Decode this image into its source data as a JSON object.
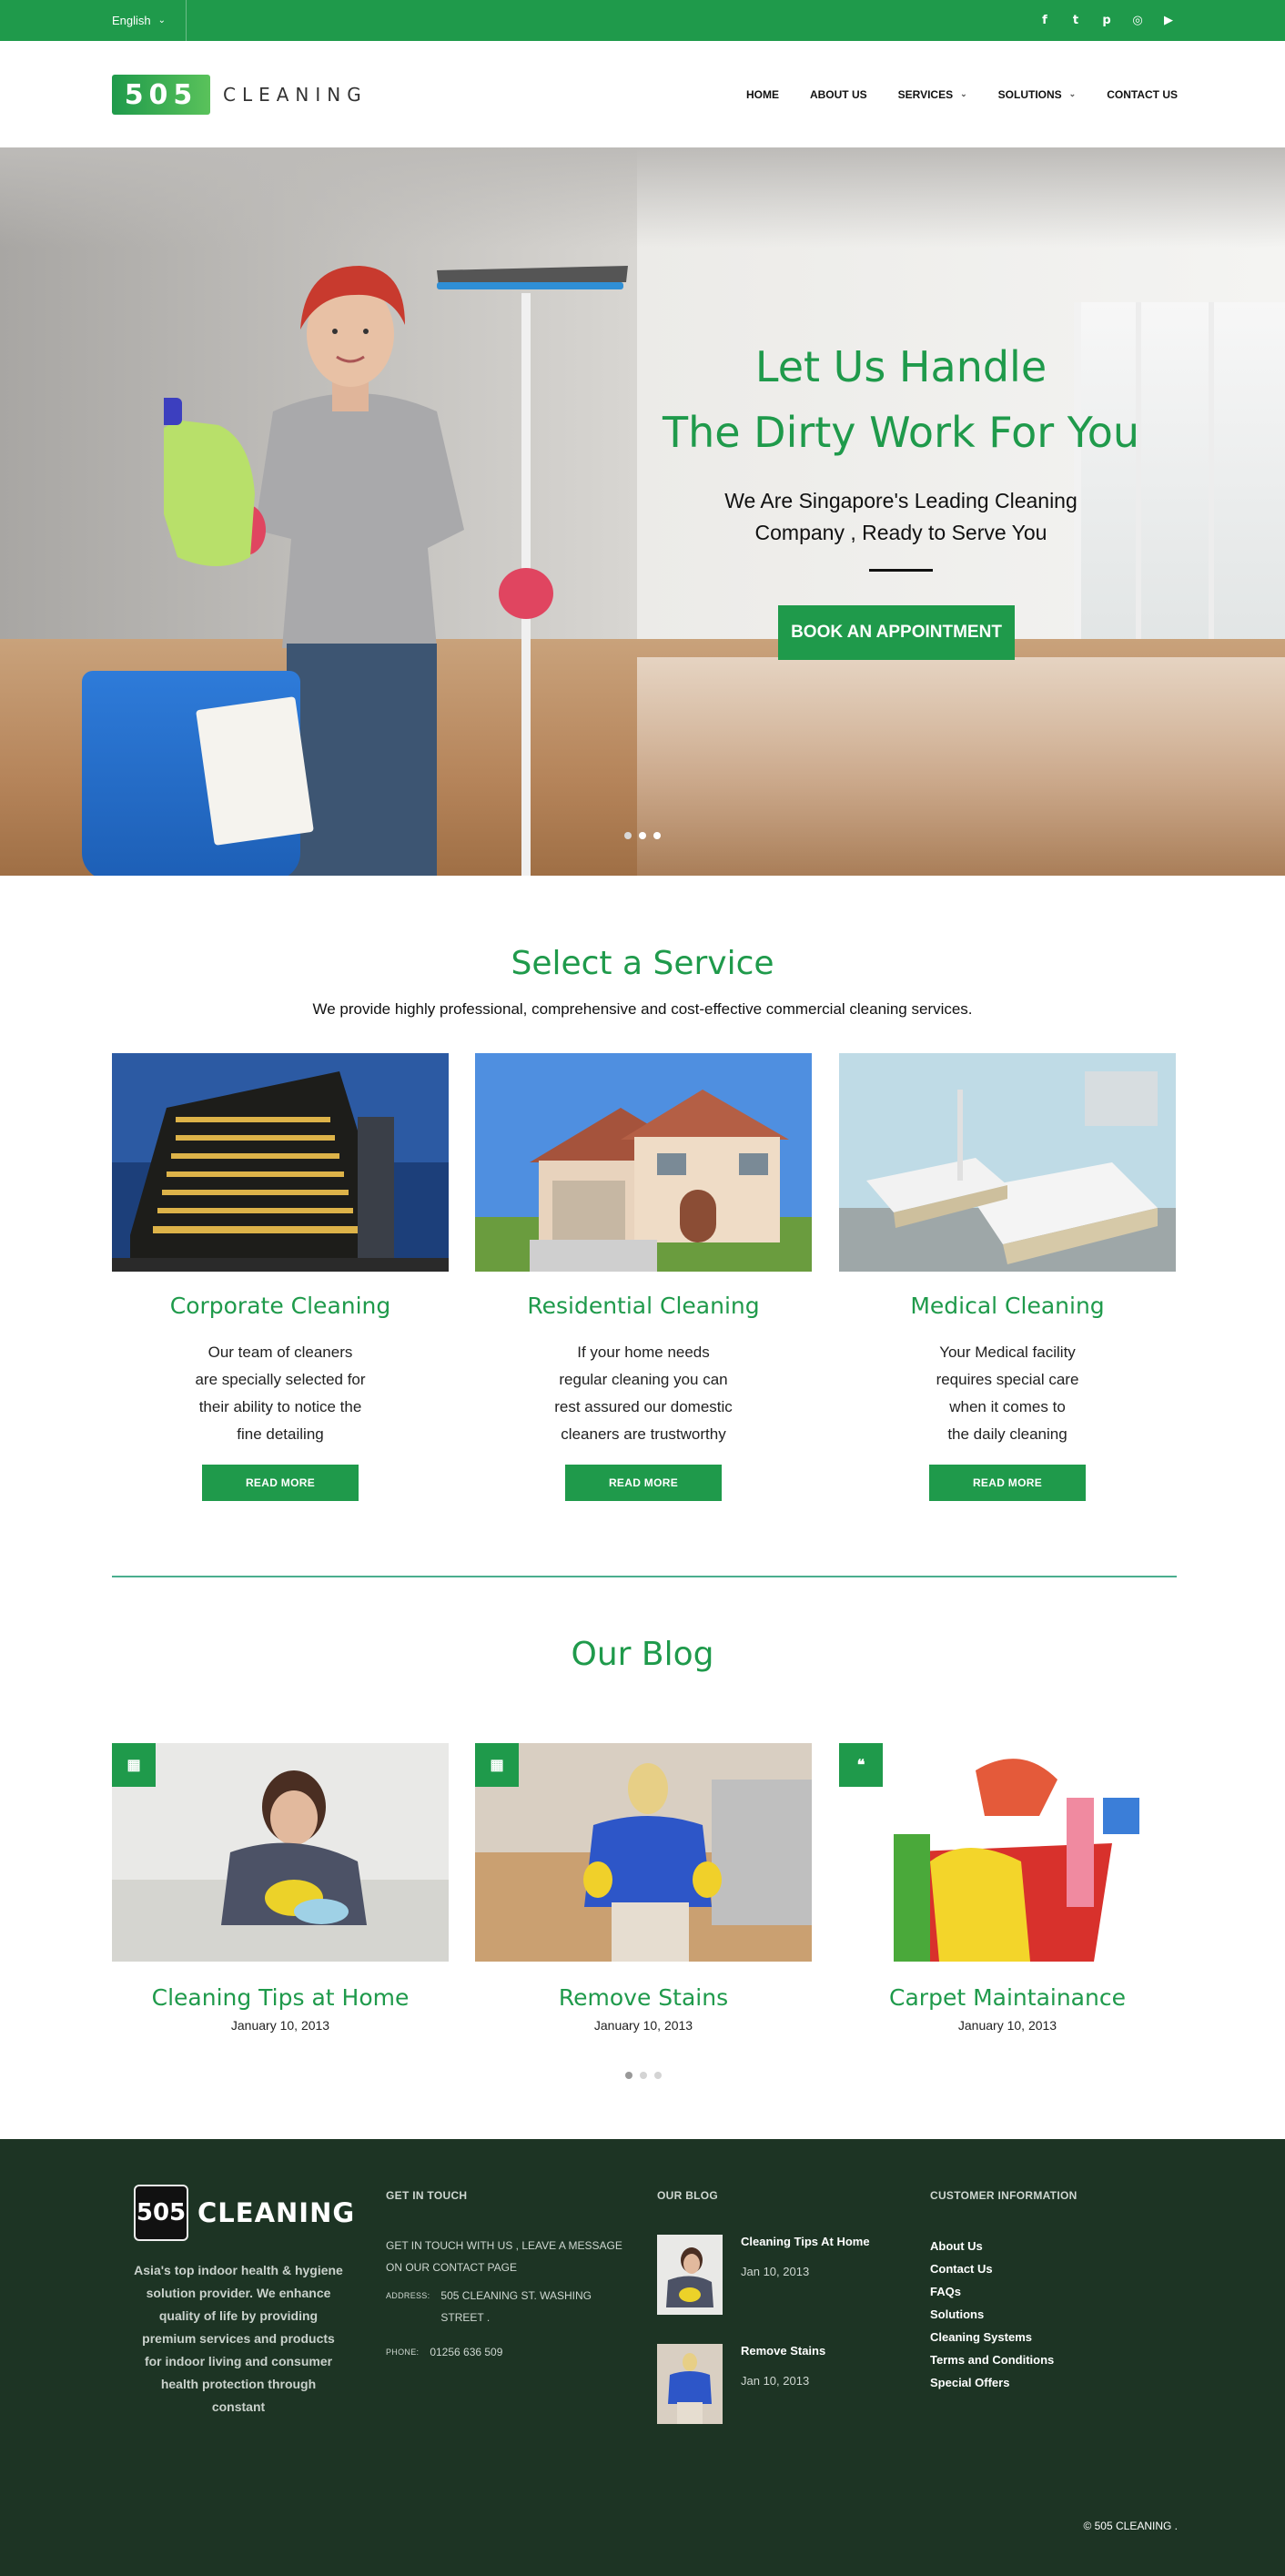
{
  "topbar": {
    "language": "English",
    "social": [
      "facebook-icon",
      "twitter-icon",
      "pinterest-icon",
      "instagram-icon",
      "youtube-icon"
    ],
    "social_glyphs": [
      "f",
      "t",
      "p",
      "◎",
      "▶"
    ]
  },
  "header": {
    "logo_mark": "505",
    "logo_text": "CLEANING",
    "nav": [
      "HOME",
      "ABOUT US",
      "SERVICES",
      "SOLUTIONS",
      "CONTACT US"
    ]
  },
  "hero": {
    "title_line1": "Let Us Handle",
    "title_line2": "The Dirty Work For You",
    "subtitle_line1": "We Are Singapore's Leading Cleaning",
    "subtitle_line2": "Company , Ready to Serve You",
    "button": "BOOK AN APPOINTMENT",
    "slide_count": 3,
    "active_slide": 2
  },
  "services": {
    "title": "Select a Service",
    "subtitle": "We provide highly professional, comprehensive and cost-effective commercial cleaning services.",
    "items": [
      {
        "title": "Corporate Cleaning",
        "lines": [
          "Our team of cleaners",
          "are specially selected for",
          "their ability to notice the",
          "fine detailing"
        ],
        "button": "READ MORE"
      },
      {
        "title": "Residential Cleaning",
        "lines": [
          "If your home needs",
          "regular cleaning you can",
          "rest assured our domestic",
          "cleaners are trustworthy"
        ],
        "button": "READ MORE"
      },
      {
        "title": "Medical Cleaning",
        "lines": [
          "Your Medical facility",
          "requires special care",
          "when it comes to",
          "the daily cleaning"
        ],
        "button": "READ MORE"
      }
    ]
  },
  "blog": {
    "title": "Our Blog",
    "posts": [
      {
        "title": "Cleaning Tips at Home",
        "date": "January 10, 2013",
        "badge": "▦"
      },
      {
        "title": "Remove Stains",
        "date": "January 10, 2013",
        "badge": "▦"
      },
      {
        "title": "Carpet Maintainance",
        "date": "January 10, 2013",
        "badge": "❝"
      }
    ]
  },
  "footer": {
    "logo_mark": "505",
    "logo_text": "CLEANING",
    "about": "Asia's top indoor health & hygiene solution provider. We enhance quality of life by providing premium services and products for indoor living and consumer health protection through constant",
    "get_in_touch": {
      "heading": "GET IN TOUCH",
      "text": "GET IN TOUCH WITH US , LEAVE A MESSAGE ON OUR CONTACT PAGE",
      "address_label": "ADDRESS:",
      "address_line1": "505 CLEANING ST. WASHING",
      "address_line2": "STREET .",
      "phone_label": "PHONE:",
      "phone": "01256 636 509"
    },
    "our_blog": {
      "heading": "OUR BLOG",
      "posts": [
        {
          "title": "Cleaning Tips At Home",
          "date": "Jan 10, 2013"
        },
        {
          "title": "Remove Stains",
          "date": "Jan 10, 2013"
        }
      ]
    },
    "customer_info": {
      "heading": "CUSTOMER INFORMATION",
      "links": [
        "About Us",
        "Contact Us",
        "FAQs",
        "Solutions",
        "Cleaning Systems",
        "Terms and Conditions",
        "Special Offers"
      ]
    },
    "copyright": "© 505 CLEANING ."
  },
  "colors": {
    "brand_green": "#1f9a4b",
    "footer_bg": "#1d3424",
    "divider": "#4aae8e"
  }
}
